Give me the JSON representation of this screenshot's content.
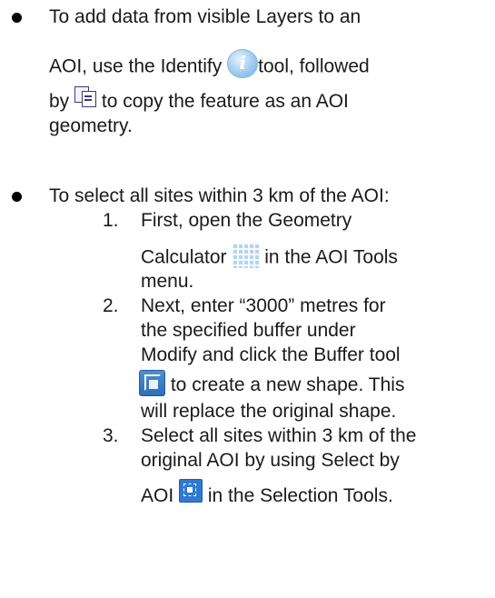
{
  "bullet1": {
    "line1": "To add data from visible Layers to an",
    "line2_before": "AOI, use the Identify",
    "line2_after": "tool, followed",
    "line3_before": "by",
    "line3_after": "to copy the feature as an AOI",
    "line4": "geometry."
  },
  "bullet2": {
    "intro": "To select all sites within 3 km of the AOI:",
    "steps": [
      {
        "number": "1.",
        "line1": "First, open the Geometry",
        "line2_before": "Calculator",
        "line2_after": "in the AOI Tools",
        "line3": "menu."
      },
      {
        "number": "2.",
        "line1": "Next, enter “3000” metres for",
        "line2": "the specified buffer under",
        "line3": "Modify and click the Buffer tool",
        "line4_after": "to create a new shape. This",
        "line5": "will replace the original shape."
      },
      {
        "number": "3.",
        "line1": "Select all sites within 3 km of the",
        "line2": "original AOI by using Select by",
        "line3_before": "AOI",
        "line3_after": "in the Selection Tools."
      }
    ]
  },
  "icons": {
    "identify": "identify-icon",
    "identify_glyph": "i",
    "copy": "copy-icon",
    "calculator": "geometry-calculator-icon",
    "buffer": "buffer-icon",
    "select_by_aoi": "select-by-aoi-icon"
  }
}
